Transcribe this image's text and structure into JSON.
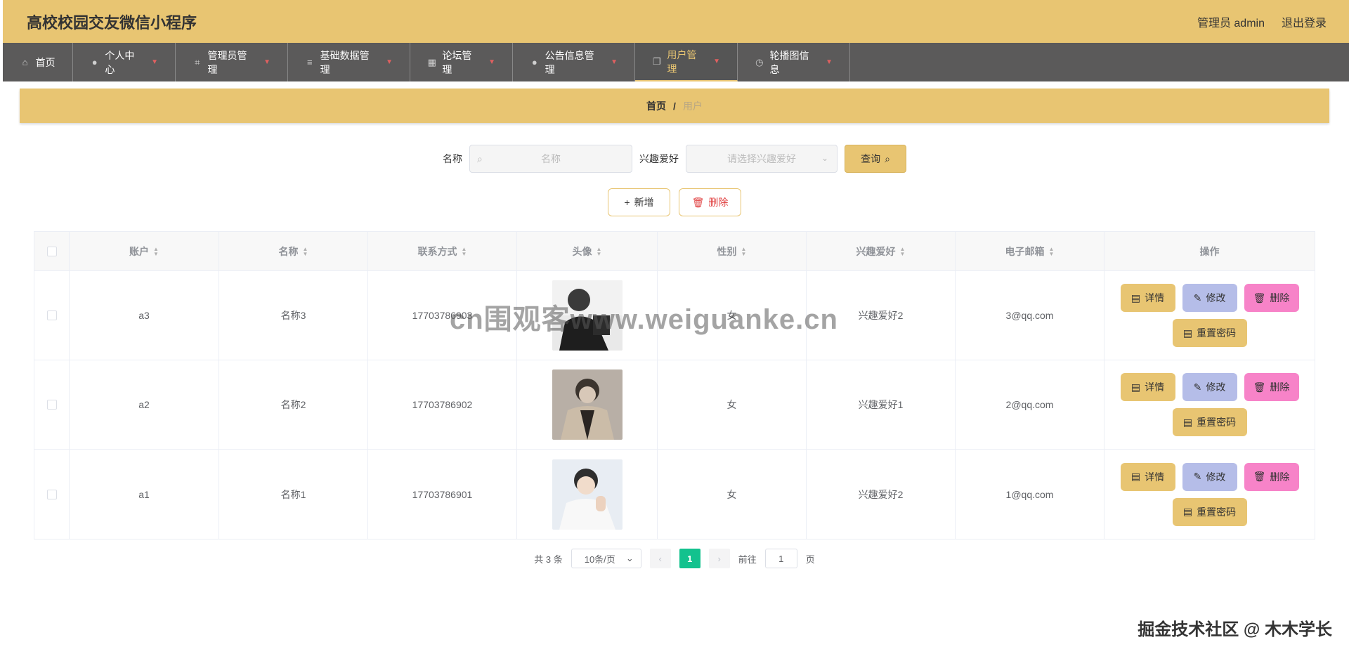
{
  "header": {
    "title": "高校校园交友微信小程序",
    "admin_label": "管理员 admin",
    "logout_label": "退出登录"
  },
  "nav": [
    {
      "label": "首页",
      "icon": "home-icon",
      "has_dropdown": false
    },
    {
      "label": "个人中心",
      "icon": "user-icon",
      "has_dropdown": true
    },
    {
      "label": "管理员管理",
      "icon": "crop-icon",
      "has_dropdown": true
    },
    {
      "label": "基础数据管理",
      "icon": "list-icon",
      "has_dropdown": true
    },
    {
      "label": "论坛管理",
      "icon": "grid-icon",
      "has_dropdown": true
    },
    {
      "label": "公告信息管理",
      "icon": "pin-icon",
      "has_dropdown": true
    },
    {
      "label": "用户管理",
      "icon": "copy-icon",
      "has_dropdown": true,
      "active": true
    },
    {
      "label": "轮播图信息",
      "icon": "clock-icon",
      "has_dropdown": true
    }
  ],
  "breadcrumb": {
    "home": "首页",
    "separator": "/",
    "current": "用户"
  },
  "search": {
    "name_label": "名称",
    "name_placeholder": "名称",
    "hobby_label": "兴趣爱好",
    "hobby_placeholder": "请选择兴趣爱好",
    "query_label": "查询"
  },
  "actions": {
    "add_label": "新增",
    "delete_label": "删除"
  },
  "table": {
    "headers": [
      "账户",
      "名称",
      "联系方式",
      "头像",
      "性别",
      "兴趣爱好",
      "电子邮箱",
      "操作"
    ],
    "rows": [
      {
        "account": "a3",
        "name": "名称3",
        "phone": "17703786903",
        "gender": "女",
        "hobby": "兴趣爱好2",
        "email": "3@qq.com"
      },
      {
        "account": "a2",
        "name": "名称2",
        "phone": "17703786902",
        "gender": "女",
        "hobby": "兴趣爱好1",
        "email": "2@qq.com"
      },
      {
        "account": "a1",
        "name": "名称1",
        "phone": "17703786901",
        "gender": "女",
        "hobby": "兴趣爱好2",
        "email": "1@qq.com"
      }
    ],
    "op_labels": {
      "detail": "详情",
      "edit": "修改",
      "remove": "删除",
      "reset": "重置密码"
    }
  },
  "pagination": {
    "total": "共 3 条",
    "page_size": "10条/页",
    "current_page": "1",
    "goto_prefix": "前往",
    "goto_value": "1",
    "goto_suffix": "页"
  },
  "watermarks": {
    "center": "cn围观客www.weiguanke.cn",
    "bottom_right": "掘金技术社区 @ 木木学长"
  },
  "colors": {
    "accent": "#e8c572",
    "nav_bg": "#5b5a5a",
    "edit_btn": "#b5bde8",
    "remove_btn": "#f783c8",
    "page_active": "#13c28e"
  }
}
